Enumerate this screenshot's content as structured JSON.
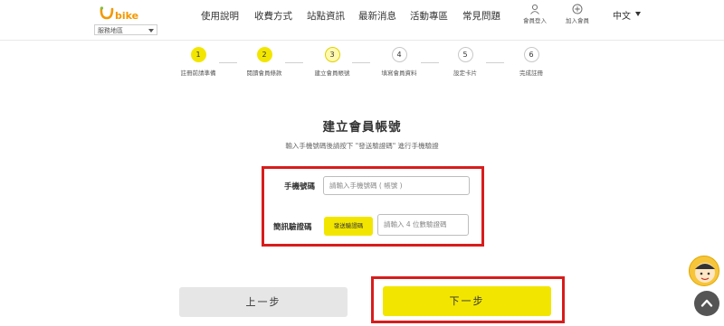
{
  "header": {
    "logo_text": "bike",
    "region_label": "服務地區",
    "nav": [
      "使用說明",
      "收費方式",
      "站點資訊",
      "最新消息",
      "活動專區",
      "常見問題"
    ],
    "member_login": "會員登入",
    "join_member": "加入會員",
    "language": "中文"
  },
  "steps": [
    {
      "num": "1",
      "label": "註冊前請準備",
      "state": "done"
    },
    {
      "num": "2",
      "label": "閱讀會員條款",
      "state": "done"
    },
    {
      "num": "3",
      "label": "建立會員帳號",
      "state": "current"
    },
    {
      "num": "4",
      "label": "填寫會員資料",
      "state": "todo"
    },
    {
      "num": "5",
      "label": "設定卡片",
      "state": "todo"
    },
    {
      "num": "6",
      "label": "完成註冊",
      "state": "todo"
    }
  ],
  "form": {
    "title": "建立會員帳號",
    "subtitle": "輸入手機號碼後請按下 \"發送驗證碼\" 進行手機驗證",
    "phone_label": "手機號碼",
    "phone_placeholder": "請輸入手機號碼 ( 帳號 )",
    "sms_label": "簡訊驗證碼",
    "send_code_button": "發送驗證碼",
    "code_placeholder": "請輸入 4 位數驗證碼"
  },
  "actions": {
    "prev": "上一步",
    "next": "下一步"
  },
  "colors": {
    "accent_yellow": "#f2e600",
    "highlight_red": "#d81c1c",
    "brand_green": "#7cc242",
    "brand_orange": "#f39800"
  },
  "icons": [
    "user-icon",
    "plus-circle-icon",
    "chevron-up-icon",
    "mascot-icon"
  ]
}
